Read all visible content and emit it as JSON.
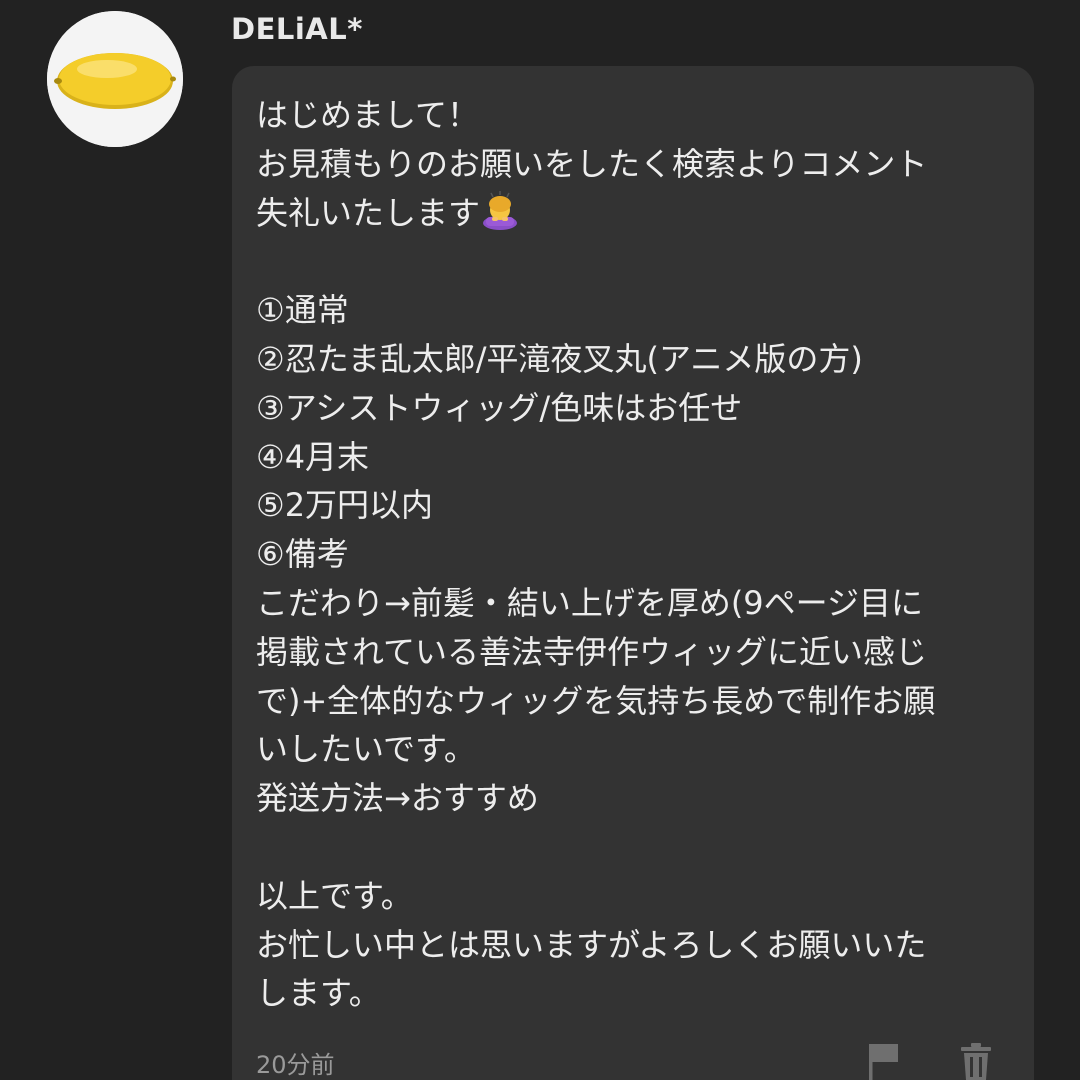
{
  "comment": {
    "username": "DELiAL*",
    "avatar_icon": "lemon-avatar",
    "lines": [
      "はじめまして！",
      "お見積もりのお願いをしたく検索よりコメント",
      "失礼いたします",
      "",
      "①通常",
      "②忍たま乱太郎/平滝夜叉丸(アニメ版の方)",
      "③アシストウィッグ/色味はお任せ",
      "④4月末",
      "⑤2万円以内",
      "⑥備考",
      "こだわり→前髪・結い上げを厚め(9ページ目に",
      "掲載されている善法寺伊作ウィッグに近い感じ",
      "で)+全体的なウィッグを気持ち長めで制作お願",
      "いしたいです。",
      "発送方法→おすすめ",
      "",
      "以上です。",
      "お忙しい中とは思いますがよろしくお願いいた",
      "します。"
    ],
    "inline_emoji": "bowing-woman-emoji",
    "timestamp": "20分前",
    "actions": {
      "report_icon": "flag-icon",
      "delete_icon": "trash-icon"
    }
  },
  "colors": {
    "background": "#222222",
    "bubble": "#333333",
    "text": "#ededed",
    "muted": "#9a9a9a"
  }
}
